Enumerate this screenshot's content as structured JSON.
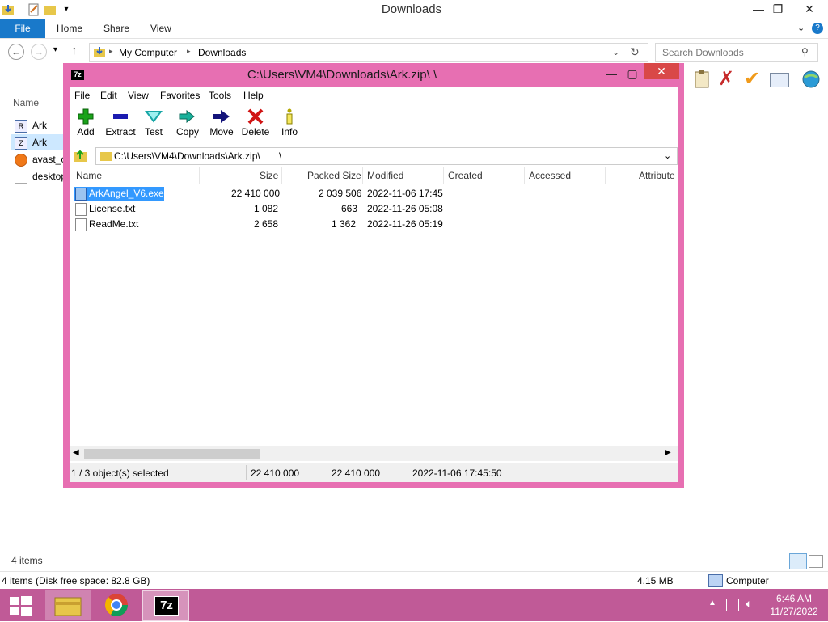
{
  "explorer": {
    "title": "Downloads",
    "ribbon_tabs": [
      "File",
      "Home",
      "Share",
      "View"
    ],
    "address": {
      "root": "My Computer",
      "current": "Downloads"
    },
    "search_placeholder": "Search Downloads",
    "name_column": "Name",
    "items": [
      "Ark",
      "Ark",
      "avast_o",
      "desktop"
    ],
    "item_count": "4 items",
    "status_left": "4 items (Disk free space: 82.8 GB)",
    "status_size": "4.15 MB",
    "status_location": "Computer"
  },
  "sevenzip": {
    "title": "C:\\Users\\VM4\\Downloads\\Ark.zip\\       \\",
    "menu": [
      "File",
      "Edit",
      "View",
      "Favorites",
      "Tools",
      "Help"
    ],
    "toolbar": [
      {
        "label": "Add",
        "icon": "plus-icon",
        "color": "#1aa31a"
      },
      {
        "label": "Extract",
        "icon": "minus-icon",
        "color": "#1b1bb0"
      },
      {
        "label": "Test",
        "icon": "check-down-icon",
        "color": "#18a6a6"
      },
      {
        "label": "Copy",
        "icon": "double-arrow-icon",
        "color": "#0a8a7a"
      },
      {
        "label": "Move",
        "icon": "arrow-right-icon",
        "color": "#14147a"
      },
      {
        "label": "Delete",
        "icon": "x-icon",
        "color": "#d01414"
      },
      {
        "label": "Info",
        "icon": "info-icon",
        "color": "#b3a800"
      }
    ],
    "path": "C:\\Users\\VM4\\Downloads\\Ark.zip\\       \\",
    "columns": [
      "Name",
      "Size",
      "Packed Size",
      "Modified",
      "Created",
      "Accessed",
      "Attribute"
    ],
    "files": [
      {
        "name": "ArkAngel_V6.exe",
        "size": "22 410 000",
        "packed": "2 039 506",
        "modified": "2022-11-06 17:45",
        "selected": true
      },
      {
        "name": "License.txt",
        "size": "1 082",
        "packed": "663",
        "modified": "2022-11-26 05:08",
        "selected": false
      },
      {
        "name": "ReadMe.txt",
        "size": "2 658",
        "packed": "1 362",
        "modified": "2022-11-26 05:19",
        "selected": false
      }
    ],
    "status": {
      "selected": "1 / 3 object(s) selected",
      "size": "22 410 000",
      "packed": "22 410 000",
      "modified": "2022-11-06 17:45:50"
    }
  },
  "taskbar": {
    "time": "6:46 AM",
    "date": "11/27/2022",
    "active_app_label": "7z"
  },
  "colors": {
    "sevenzip_frame": "#e76fb2",
    "taskbar": "#c05a97",
    "file_tab": "#1979ca",
    "selection": "#3399ff"
  }
}
